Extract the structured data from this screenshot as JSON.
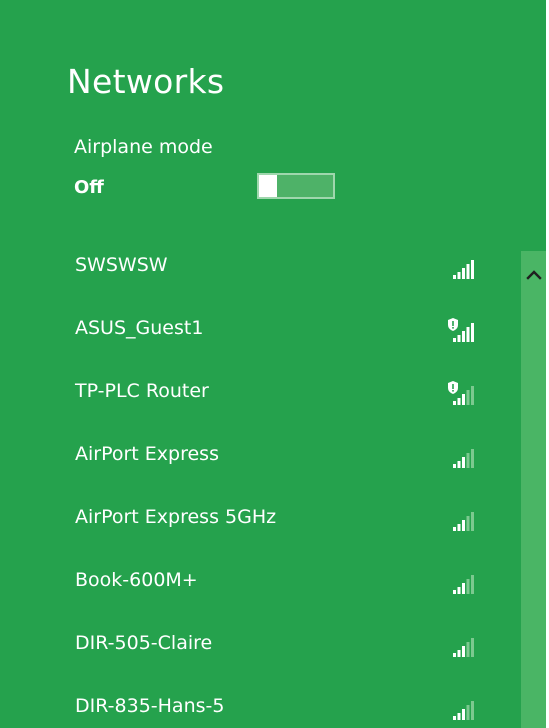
{
  "panel": {
    "title": "Networks",
    "background": "#25a24d",
    "airplane_mode": {
      "label": "Airplane mode",
      "state": "Off",
      "enabled": false
    }
  },
  "networks": [
    {
      "name": "SWSWSW",
      "signal_bars": 5,
      "secured_warning": false,
      "icon": "wifi-signal-icon"
    },
    {
      "name": "ASUS_Guest1",
      "signal_bars": 5,
      "secured_warning": true,
      "icon": "wifi-signal-shield-icon"
    },
    {
      "name": "TP-PLC Router",
      "signal_bars": 3,
      "secured_warning": true,
      "icon": "wifi-signal-shield-icon"
    },
    {
      "name": "AirPort Express",
      "signal_bars": 3,
      "secured_warning": false,
      "icon": "wifi-signal-icon"
    },
    {
      "name": "AirPort Express 5GHz",
      "signal_bars": 3,
      "secured_warning": false,
      "icon": "wifi-signal-icon"
    },
    {
      "name": "Book-600M+",
      "signal_bars": 3,
      "secured_warning": false,
      "icon": "wifi-signal-icon"
    },
    {
      "name": "DIR-505-Claire",
      "signal_bars": 3,
      "secured_warning": false,
      "icon": "wifi-signal-icon"
    },
    {
      "name": "DIR-835-Hans-5",
      "signal_bars": 3,
      "secured_warning": false,
      "icon": "wifi-signal-icon"
    }
  ],
  "scrollbar": {
    "icon": "chevron-up-icon"
  }
}
